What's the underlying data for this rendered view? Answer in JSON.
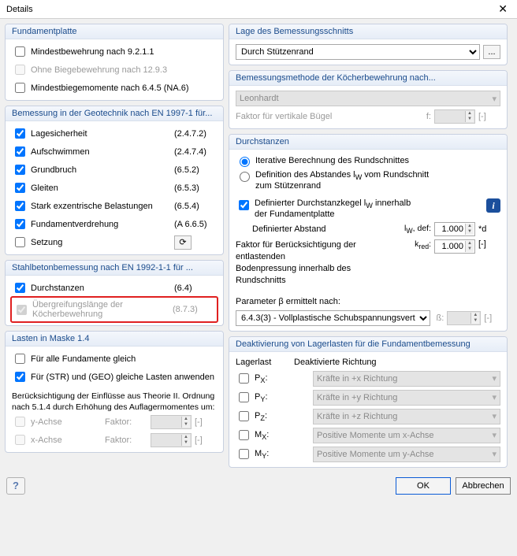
{
  "titlebar": {
    "title": "Details"
  },
  "fundamentplatte": {
    "header": "Fundamentplatte",
    "mindestbewehrung": {
      "label": "Mindestbewehrung nach 9.2.1.1",
      "checked": false
    },
    "ohne_biege": {
      "label": "Ohne Biegebewehrung nach 12.9.3"
    },
    "mindestbiege": {
      "label": "Mindestbiegemomente nach 6.4.5 (NA.6)",
      "checked": false
    }
  },
  "geotechnik": {
    "header": "Bemessung in der Geotechnik nach EN 1997-1 für...",
    "items": [
      {
        "label": "Lagesicherheit",
        "ref": "(2.4.7.2)",
        "checked": true
      },
      {
        "label": "Aufschwimmen",
        "ref": "(2.4.7.4)",
        "checked": true
      },
      {
        "label": "Grundbruch",
        "ref": "(6.5.2)",
        "checked": true
      },
      {
        "label": "Gleiten",
        "ref": "(6.5.3)",
        "checked": true
      },
      {
        "label": "Stark exzentrische Belastungen",
        "ref": "(6.5.4)",
        "checked": true
      },
      {
        "label": "Fundamentverdrehung",
        "ref": "(A 6.6.5)",
        "checked": true
      },
      {
        "label": "Setzung",
        "ref": "",
        "checked": false,
        "icon": true
      }
    ]
  },
  "stahlbeton": {
    "header": "Stahlbetonbemessung nach EN 1992-1-1 für ...",
    "durchstanzen": {
      "label": "Durchstanzen",
      "ref": "(6.4)",
      "checked": true
    },
    "uebergreif": {
      "label": "Übergreifungslänge der Köcherbewehrung",
      "ref": "(8.7.3)"
    }
  },
  "lasten": {
    "header": "Lasten in Maske 1.4",
    "alle": {
      "label": "Für alle Fundamente gleich",
      "checked": false
    },
    "str_geo": {
      "label": "Für (STR) und (GEO) gleiche Lasten anwenden",
      "checked": true
    },
    "theorie_note": "Berücksichtigung der Einflüsse aus Theorie II. Ordnung nach 5.1.4 durch Erhöhung des Auflagermomentes um:",
    "y": {
      "label": "y-Achse",
      "faktor": "Faktor:",
      "unit": "[-]"
    },
    "x": {
      "label": "x-Achse",
      "faktor": "Faktor:",
      "unit": "[-]"
    }
  },
  "lage_schnitt": {
    "header": "Lage des Bemessungsschnitts",
    "selected": "Durch Stützenrand",
    "btn": "..."
  },
  "koecher_methode": {
    "header": "Bemessungsmethode der Köcherbewehrung nach...",
    "selected": "Leonhardt",
    "faktor_label": "Faktor für vertikale Bügel",
    "faktor_sym": "f:",
    "unit": "[-]"
  },
  "durchstanzen_grp": {
    "header": "Durchstanzen",
    "iterative": {
      "label": "Iterative Berechnung des Rundschnittes",
      "selected": true
    },
    "definition_abstand": {
      "line1": "Definition des Abstandes l",
      "sub": "W",
      "line2": " vom Rundschnitt",
      "line3": "zum Stützenrand",
      "selected": false
    },
    "kegel": {
      "line1": "Definierter Durchstanzkegel l",
      "sub": "W",
      "line2": " innerhalb",
      "line3": "der Fundamentplatte",
      "checked": true
    },
    "def_abstand": {
      "label": "Definierter Abstand",
      "sym": "lW, def:",
      "val": "1.000",
      "unit": "*d"
    },
    "faktor_entlast": {
      "line1": "Faktor für Berücksichtigung der entlastenden",
      "line2": "Bodenpressung innerhalb des Rundschnitts",
      "sym": "kred:",
      "val": "1.000",
      "unit": "[-]"
    },
    "param_beta": {
      "label": "Parameter β ermittelt nach:"
    },
    "beta_select": "6.4.3(3) - Vollplastische Schubspannungsvert",
    "beta_sym": "ß:",
    "beta_unit": "[-]"
  },
  "deaktivierung": {
    "header": "Deaktivierung von Lagerlasten für die Fundamentbemessung",
    "col1": "Lagerlast",
    "col2": "Deaktivierte Richtung",
    "rows": [
      {
        "load": "PX:",
        "dir": "Kräfte in +x Richtung"
      },
      {
        "load": "PY:",
        "dir": "Kräfte in +y Richtung"
      },
      {
        "load": "PZ:",
        "dir": "Kräfte in +z Richtung"
      },
      {
        "load": "MX:",
        "dir": "Positive Momente um x-Achse"
      },
      {
        "load": "MY:",
        "dir": "Positive Momente um y-Achse"
      }
    ]
  },
  "buttons": {
    "ok": "OK",
    "cancel": "Abbrechen",
    "help": "?"
  }
}
